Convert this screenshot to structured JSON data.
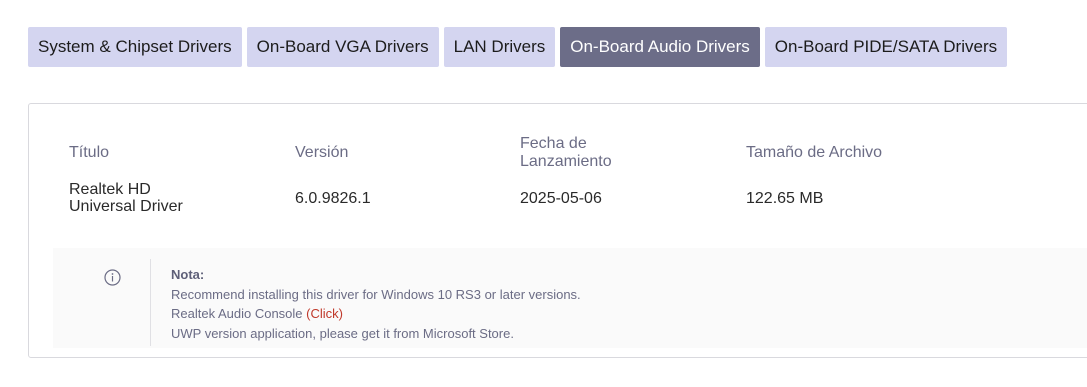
{
  "tabs": [
    {
      "label": "System & Chipset Drivers",
      "active": false
    },
    {
      "label": "On-Board VGA Drivers",
      "active": false
    },
    {
      "label": "LAN Drivers",
      "active": false
    },
    {
      "label": "On-Board Audio Drivers",
      "active": true
    },
    {
      "label": "On-Board PIDE/SATA Drivers",
      "active": false
    }
  ],
  "table": {
    "headers": {
      "title": "Título",
      "version": "Versión",
      "date_line1": "Fecha de",
      "date_line2": "Lanzamiento",
      "size": "Tamaño de Archivo"
    },
    "row": {
      "title_line1": "Realtek HD",
      "title_line2": "Universal Driver",
      "version": "6.0.9826.1",
      "date": "2025-05-06",
      "size": "122.65 MB"
    }
  },
  "note": {
    "icon": "info-icon",
    "title": "Nota:",
    "line1": "Recommend installing this driver for Windows 10 RS3 or later versions.",
    "line2_prefix": "Realtek Audio Console ",
    "line2_link": "(Click)",
    "line3": "UWP version application, please get it from Microsoft Store."
  },
  "colors": {
    "tab_bg": "#d4d5f0",
    "tab_active_bg": "#6c6d88",
    "label_text": "#6b6c85",
    "link": "#c0392b"
  }
}
